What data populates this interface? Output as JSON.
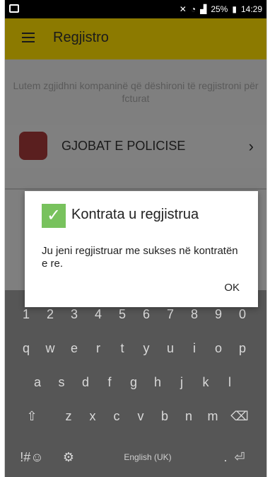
{
  "status_bar": {
    "right_text": "25%",
    "time": "14:29"
  },
  "app_bar": {
    "title": "Regjistro",
    "menu_icon": "hamburger-menu-icon"
  },
  "page": {
    "instruction": "Lutem zgjidhni kompaninë që dëshironi të regjistroni për fcturat",
    "items": [
      {
        "label": "GJOBAT E POLICISE",
        "icon": "police-badge-icon",
        "chevron": "chevron-right-icon"
      }
    ]
  },
  "dialog": {
    "title": "Kontrata u regjistrua",
    "message": "Ju jeni regjistruar me sukses në kontratën e re.",
    "ok_label": "OK",
    "check_icon": "check-icon",
    "check_color": "#78c25d"
  },
  "keyboard": {
    "row0": [
      "1",
      "2",
      "3",
      "4",
      "5",
      "6",
      "7",
      "8",
      "9",
      "0"
    ],
    "row1": [
      "q",
      "w",
      "e",
      "r",
      "t",
      "y",
      "u",
      "i",
      "o",
      "p"
    ],
    "row2": [
      "a",
      "s",
      "d",
      "f",
      "g",
      "h",
      "j",
      "k",
      "l"
    ],
    "row3": [
      "z",
      "x",
      "c",
      "v",
      "b",
      "n",
      "m"
    ],
    "space_label": "English (UK)",
    "symbols_label": "!#☺",
    "shift_label": "⇧",
    "backspace_label": "⌫",
    "settings_label": "⚙",
    "dot_label": ".",
    "enter_label": "⏎"
  }
}
